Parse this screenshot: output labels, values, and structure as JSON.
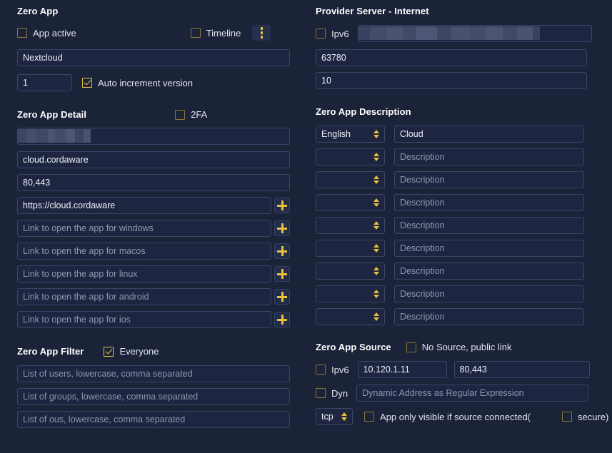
{
  "left": {
    "app_section": {
      "title": "Zero App",
      "app_active_label": "App active",
      "timeline_label": "Timeline",
      "menu_icon": "vertical-dots-icon",
      "name_value": "Nextcloud",
      "version_value": "1",
      "auto_increment_label": "Auto increment version"
    },
    "detail_section": {
      "title": "Zero App Detail",
      "twofa_label": "2FA",
      "redacted_value": "",
      "host_value": "cloud.cordaware",
      "ports_value": "80,443",
      "url_value": "https://cloud.cordaware",
      "link_rows": [
        {
          "placeholder": "Link to open the app for windows",
          "value": ""
        },
        {
          "placeholder": "Link to open the app for macos",
          "value": ""
        },
        {
          "placeholder": "Link to open the app for linux",
          "value": ""
        },
        {
          "placeholder": "Link to open the app for android",
          "value": ""
        },
        {
          "placeholder": "Link to open the app for ios",
          "value": ""
        }
      ],
      "add_icon": "plus-icon"
    },
    "filter_section": {
      "title": "Zero App Filter",
      "everyone_label": "Everyone",
      "users_placeholder": "List of users, lowercase, comma separated",
      "groups_placeholder": "List of groups, lowercase, comma separated",
      "ous_placeholder": "List of ous, lowercase, comma separated"
    }
  },
  "right": {
    "provider_section": {
      "title": "Provider Server - Internet",
      "ipv6_label": "Ipv6",
      "address_value": "",
      "port_value": "63780",
      "count_value": "10"
    },
    "description_section": {
      "title": "Zero App Description",
      "rows": [
        {
          "language": "English",
          "description": "Cloud",
          "description_placeholder": "Description"
        },
        {
          "language": "",
          "description": "",
          "description_placeholder": "Description"
        },
        {
          "language": "",
          "description": "",
          "description_placeholder": "Description"
        },
        {
          "language": "",
          "description": "",
          "description_placeholder": "Description"
        },
        {
          "language": "",
          "description": "",
          "description_placeholder": "Description"
        },
        {
          "language": "",
          "description": "",
          "description_placeholder": "Description"
        },
        {
          "language": "",
          "description": "",
          "description_placeholder": "Description"
        },
        {
          "language": "",
          "description": "",
          "description_placeholder": "Description"
        },
        {
          "language": "",
          "description": "",
          "description_placeholder": "Description"
        }
      ]
    },
    "source_section": {
      "title": "Zero App Source",
      "no_source_label": "No Source, public link",
      "ipv6_label": "Ipv6",
      "source_ip_value": "10.120.1.11",
      "source_port_value": "80,443",
      "dyn_label": "Dyn",
      "dyn_placeholder": "Dynamic Address as Regular Expression",
      "protocol_value": "tcp",
      "only_visible_label": "App only visible if source connected(",
      "secure_label": "secure)"
    }
  },
  "colors": {
    "background": "#1b2338",
    "accent": "#e8c13c",
    "input_border": "#3b4665",
    "text": "#e8ecf5",
    "placeholder": "#8e97ad"
  }
}
